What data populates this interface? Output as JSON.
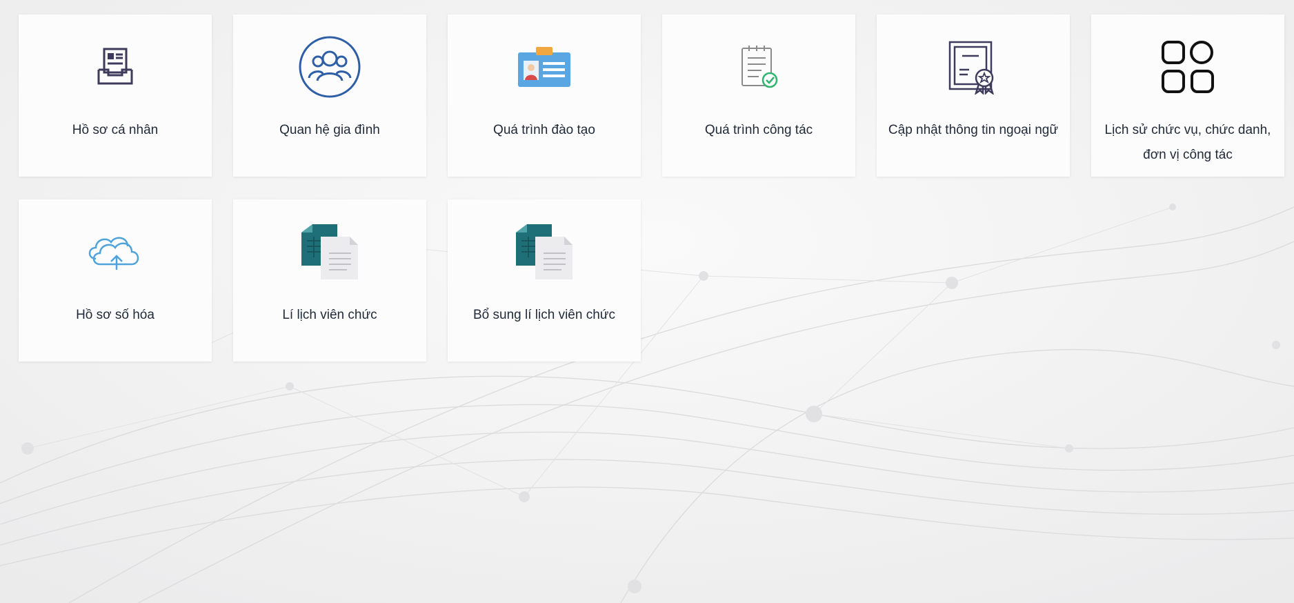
{
  "tiles": [
    {
      "label": "Hồ sơ cá nhân",
      "icon": "profile-tray-icon"
    },
    {
      "label": "Quan hệ gia đình",
      "icon": "family-group-icon"
    },
    {
      "label": "Quá trình đào tạo",
      "icon": "id-card-icon"
    },
    {
      "label": "Quá trình công tác",
      "icon": "checklist-clipboard-icon"
    },
    {
      "label": "Cập nhật thông tin ngoại ngữ",
      "icon": "certificate-icon"
    },
    {
      "label": "Lịch sử chức vụ, chức danh, đơn vị công tác",
      "icon": "grid-apps-icon"
    },
    {
      "label": "Hồ sơ số hóa",
      "icon": "cloud-upload-icon"
    },
    {
      "label": "Lí lịch viên chức",
      "icon": "document-files-icon"
    },
    {
      "label": "Bổ sung lí lịch viên chức",
      "icon": "document-files-icon"
    }
  ],
  "colors": {
    "icon_dark": "#3d3a5c",
    "icon_blue": "#2e5fa6",
    "teal": "#1f6f78",
    "check_green": "#2fb36d",
    "cloud_blue": "#4fa3d9"
  }
}
